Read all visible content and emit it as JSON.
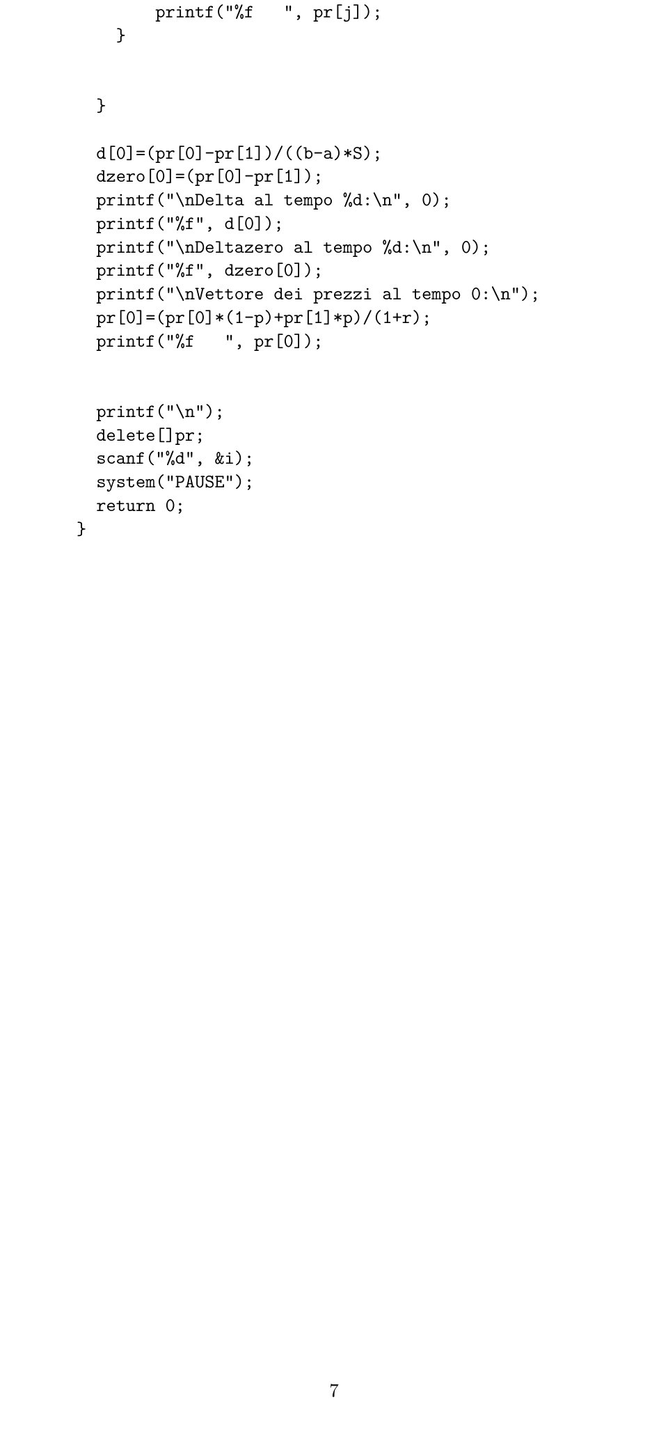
{
  "code_lines": [
    "        printf(\"%f   \", pr[j]);",
    "    }",
    "",
    "",
    "  }",
    "",
    "  d[0]=(pr[0]-pr[1])/((b-a)*S);",
    "  dzero[0]=(pr[0]-pr[1]);",
    "  printf(\"\\nDelta al tempo %d:\\n\", 0);",
    "  printf(\"%f\", d[0]);",
    "  printf(\"\\nDeltazero al tempo %d:\\n\", 0);",
    "  printf(\"%f\", dzero[0]);",
    "  printf(\"\\nVettore dei prezzi al tempo 0:\\n\");",
    "  pr[0]=(pr[0]*(1-p)+pr[1]*p)/(1+r);",
    "  printf(\"%f   \", pr[0]);",
    "",
    "",
    "  printf(\"\\n\");",
    "  delete[]pr;",
    "  scanf(\"%d\", &i);",
    "  system(\"PAUSE\");",
    "  return 0;",
    "}"
  ],
  "page_number": "7"
}
